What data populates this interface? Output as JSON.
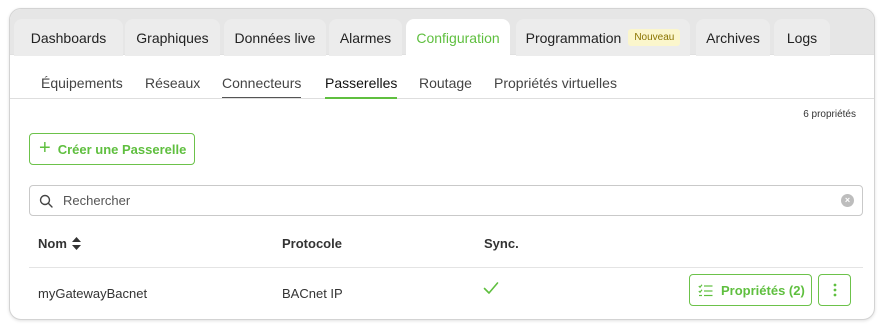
{
  "tabs": [
    {
      "label": "Dashboards"
    },
    {
      "label": "Graphiques"
    },
    {
      "label": "Données live"
    },
    {
      "label": "Alarmes"
    },
    {
      "label": "Configuration",
      "active": true
    },
    {
      "label": "Programmation",
      "badge": "Nouveau"
    },
    {
      "label": "Archives"
    },
    {
      "label": "Logs"
    }
  ],
  "subtabs": [
    {
      "label": "Équipements"
    },
    {
      "label": "Réseaux"
    },
    {
      "label": "Connecteurs"
    },
    {
      "label": "Passerelles",
      "active": true
    },
    {
      "label": "Routage"
    },
    {
      "label": "Propriétés virtuelles"
    }
  ],
  "count_text": "6 propriétés",
  "create_button": "Créer une Passerelle",
  "search": {
    "placeholder": "Rechercher",
    "value": ""
  },
  "table": {
    "columns": [
      "Nom",
      "Protocole",
      "Sync."
    ],
    "rows": [
      {
        "name": "myGatewayBacnet",
        "protocol": "BACnet IP",
        "sync": true,
        "props_label": "Propriétés (2)"
      }
    ]
  },
  "colors": {
    "accent": "#5fbf3f",
    "badge_bg": "#fbf6cc",
    "badge_text": "#8a7400"
  }
}
